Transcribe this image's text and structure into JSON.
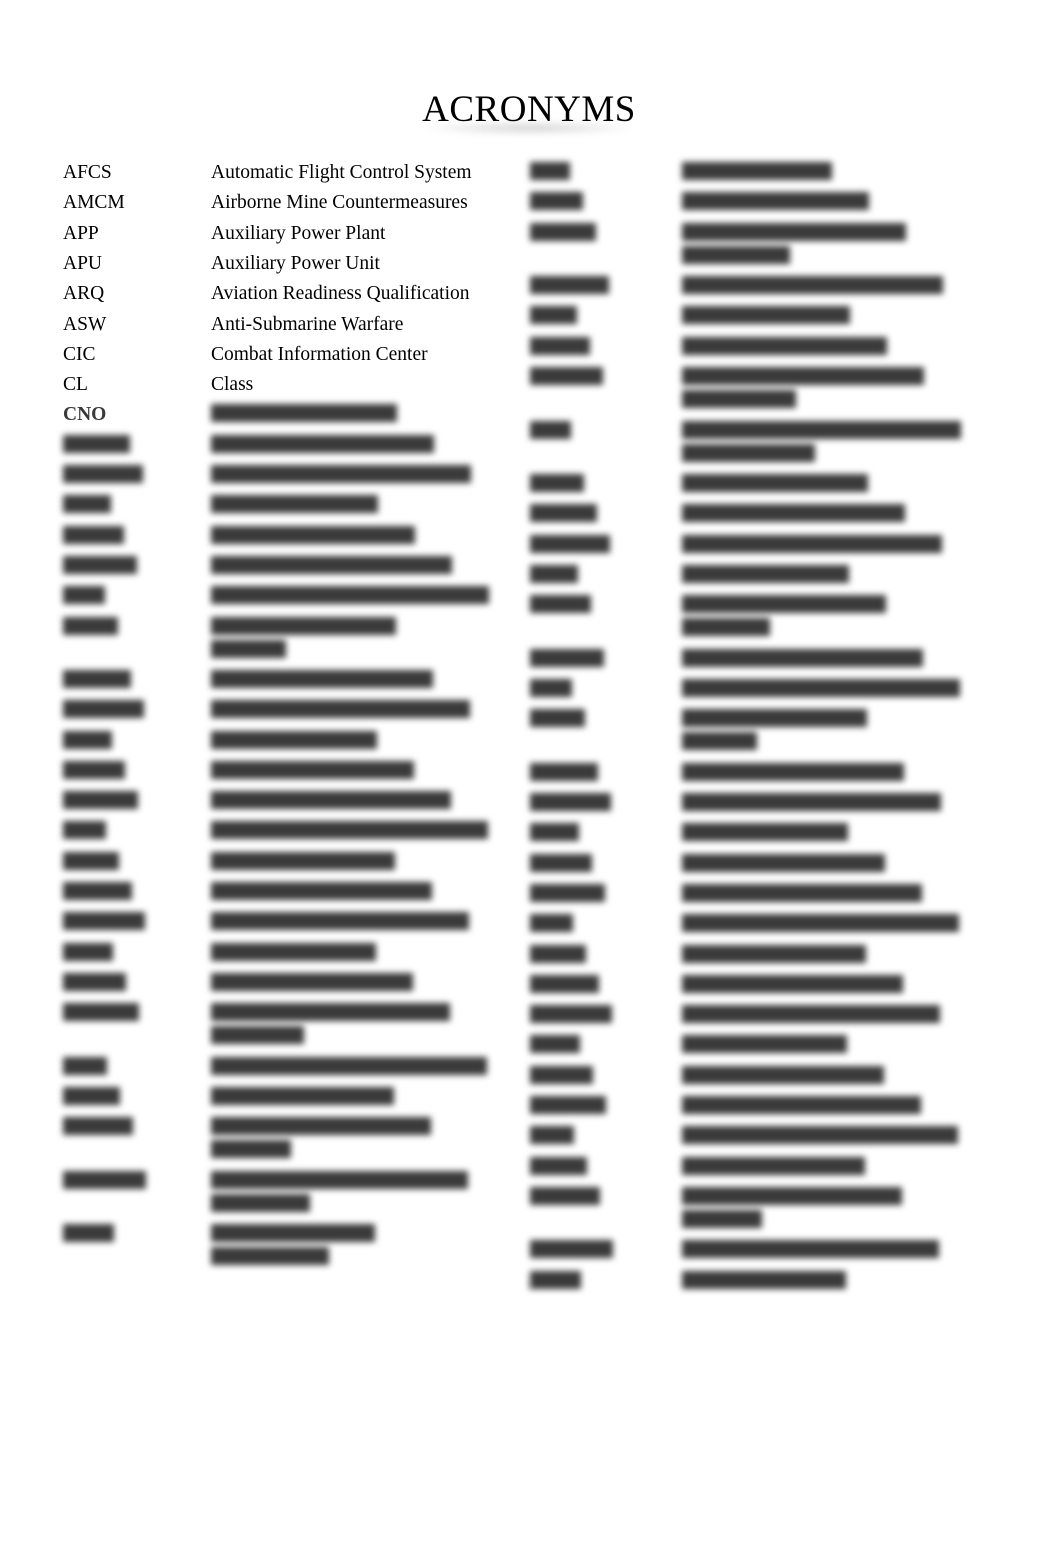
{
  "document": {
    "title": "ACRONYMS",
    "blur_note": "Rows marked legible:false are blurred in the source image and their text cannot be read.",
    "left_column": [
      {
        "acronym": "AFCS",
        "definition": "Automatic Flight Control System",
        "legible": true
      },
      {
        "acronym": "AMCM",
        "definition": "Airborne Mine Countermeasures",
        "legible": true
      },
      {
        "acronym": "APP",
        "definition": "Auxiliary Power Plant",
        "legible": true
      },
      {
        "acronym": "APU",
        "definition": "Auxiliary Power Unit",
        "legible": true
      },
      {
        "acronym": "ARQ",
        "definition": "Aviation Readiness Qualification",
        "legible": true
      },
      {
        "acronym": "ASW",
        "definition": "Anti-Submarine Warfare",
        "legible": true
      },
      {
        "acronym": "CIC",
        "definition": "Combat Information Center",
        "legible": true
      },
      {
        "acronym": "CL",
        "definition": "Class",
        "legible": true
      },
      {
        "acronym": "CNO",
        "definition": null,
        "legible": "acronym-only"
      },
      {
        "acronym": null,
        "definition": null,
        "legible": false
      },
      {
        "acronym": null,
        "definition": null,
        "legible": false
      },
      {
        "acronym": null,
        "definition": null,
        "legible": false
      },
      {
        "acronym": null,
        "definition": null,
        "legible": false
      },
      {
        "acronym": null,
        "definition": null,
        "legible": false
      },
      {
        "acronym": null,
        "definition": null,
        "legible": false
      },
      {
        "acronym": null,
        "definition": null,
        "legible": false,
        "lines": 2
      },
      {
        "acronym": null,
        "definition": null,
        "legible": false
      },
      {
        "acronym": null,
        "definition": null,
        "legible": false
      },
      {
        "acronym": null,
        "definition": null,
        "legible": false
      },
      {
        "acronym": null,
        "definition": null,
        "legible": false
      },
      {
        "acronym": null,
        "definition": null,
        "legible": false
      },
      {
        "acronym": null,
        "definition": null,
        "legible": false
      },
      {
        "acronym": null,
        "definition": null,
        "legible": false
      },
      {
        "acronym": null,
        "definition": null,
        "legible": false
      },
      {
        "acronym": null,
        "definition": null,
        "legible": false
      },
      {
        "acronym": null,
        "definition": null,
        "legible": false
      },
      {
        "acronym": null,
        "definition": null,
        "legible": false
      },
      {
        "acronym": null,
        "definition": null,
        "legible": false,
        "lines": 2
      },
      {
        "acronym": null,
        "definition": null,
        "legible": false
      },
      {
        "acronym": null,
        "definition": null,
        "legible": false
      },
      {
        "acronym": null,
        "definition": null,
        "legible": false,
        "lines": 2
      },
      {
        "acronym": null,
        "definition": null,
        "legible": false,
        "lines": 2
      },
      {
        "acronym": null,
        "definition": null,
        "legible": false,
        "lines": 2
      }
    ],
    "right_column": [
      {
        "acronym": null,
        "definition": null,
        "legible": false
      },
      {
        "acronym": null,
        "definition": null,
        "legible": false
      },
      {
        "acronym": null,
        "definition": null,
        "legible": false,
        "lines": 2
      },
      {
        "acronym": null,
        "definition": null,
        "legible": false
      },
      {
        "acronym": null,
        "definition": null,
        "legible": false
      },
      {
        "acronym": null,
        "definition": null,
        "legible": false
      },
      {
        "acronym": null,
        "definition": null,
        "legible": false,
        "lines": 2
      },
      {
        "acronym": null,
        "definition": null,
        "legible": false,
        "lines": 2
      },
      {
        "acronym": null,
        "definition": null,
        "legible": false
      },
      {
        "acronym": null,
        "definition": null,
        "legible": false
      },
      {
        "acronym": null,
        "definition": null,
        "legible": false
      },
      {
        "acronym": null,
        "definition": null,
        "legible": false
      },
      {
        "acronym": null,
        "definition": null,
        "legible": false,
        "lines": 2
      },
      {
        "acronym": null,
        "definition": null,
        "legible": false
      },
      {
        "acronym": null,
        "definition": null,
        "legible": false
      },
      {
        "acronym": null,
        "definition": null,
        "legible": false,
        "lines": 2
      },
      {
        "acronym": null,
        "definition": null,
        "legible": false
      },
      {
        "acronym": null,
        "definition": null,
        "legible": false
      },
      {
        "acronym": null,
        "definition": null,
        "legible": false
      },
      {
        "acronym": null,
        "definition": null,
        "legible": false
      },
      {
        "acronym": null,
        "definition": null,
        "legible": false
      },
      {
        "acronym": null,
        "definition": null,
        "legible": false
      },
      {
        "acronym": null,
        "definition": null,
        "legible": false
      },
      {
        "acronym": null,
        "definition": null,
        "legible": false
      },
      {
        "acronym": null,
        "definition": null,
        "legible": false
      },
      {
        "acronym": null,
        "definition": null,
        "legible": false
      },
      {
        "acronym": null,
        "definition": null,
        "legible": false
      },
      {
        "acronym": null,
        "definition": null,
        "legible": false
      },
      {
        "acronym": null,
        "definition": null,
        "legible": false
      },
      {
        "acronym": null,
        "definition": null,
        "legible": false
      },
      {
        "acronym": null,
        "definition": null,
        "legible": false,
        "lines": 2
      },
      {
        "acronym": null,
        "definition": null,
        "legible": false
      },
      {
        "acronym": null,
        "definition": null,
        "legible": false
      }
    ]
  }
}
